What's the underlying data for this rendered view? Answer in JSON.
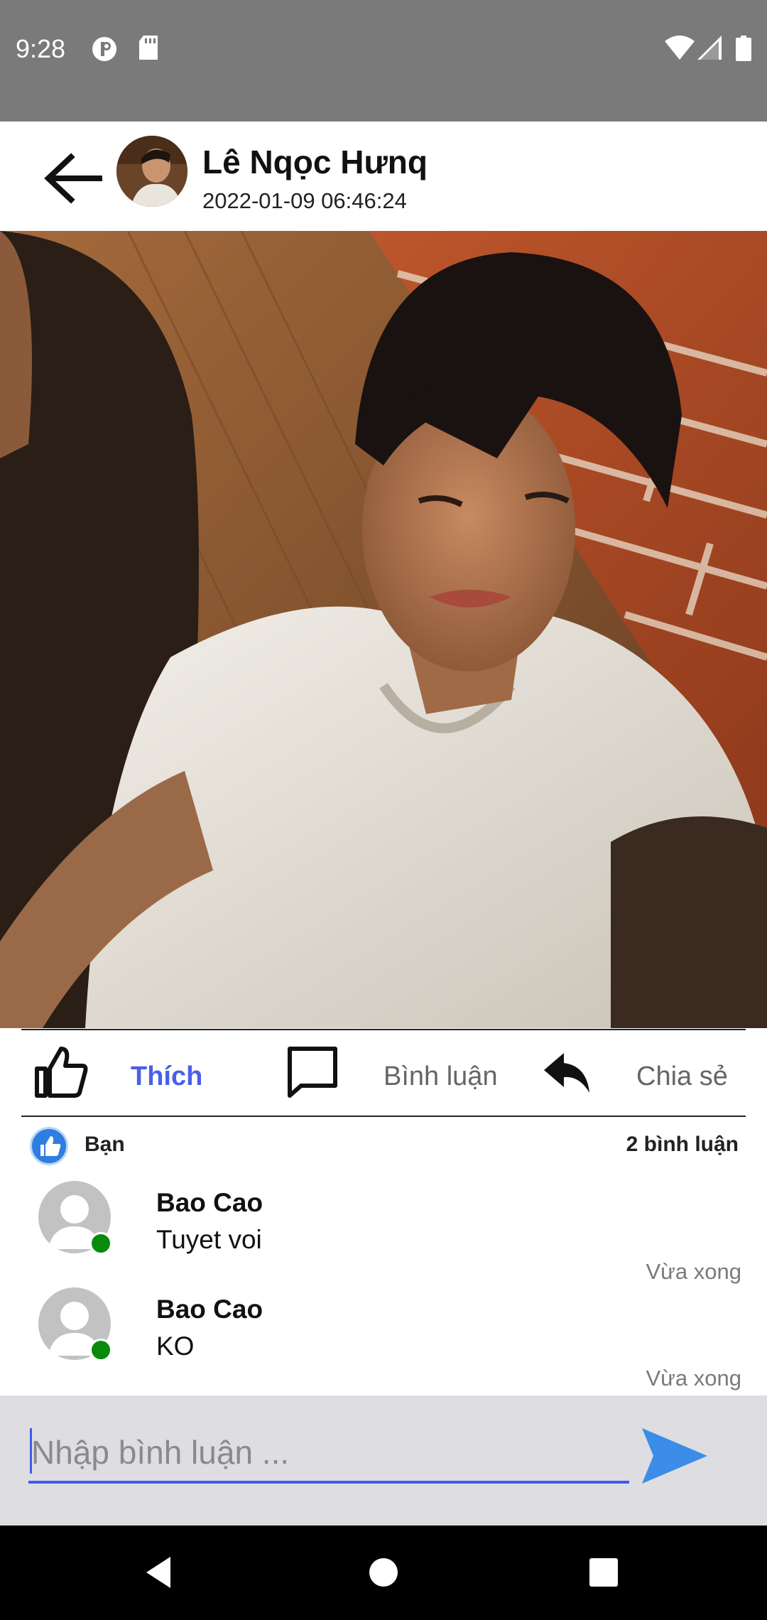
{
  "status_bar": {
    "time": "9:28"
  },
  "header": {
    "user_name": "Lê Nqọc Hưnq",
    "post_time": "2022-01-09 06:46:24"
  },
  "actions": {
    "like": "Thích",
    "comment": "Bình luận",
    "share": "Chia sẻ"
  },
  "reactions": {
    "you": "Bạn",
    "comment_count": "2 bình luận"
  },
  "comments": [
    {
      "name": "Bao Cao",
      "text": "Tuyet voi",
      "time": "Vừa xong"
    },
    {
      "name": "Bao Cao",
      "text": "KO",
      "time": "Vừa xong"
    }
  ],
  "input": {
    "placeholder": "Nhập bình luận ..."
  },
  "colors": {
    "accent": "#3f5bf2",
    "like_active": "#4a60e8",
    "send": "#3b8de8",
    "online": "#0a8a0a"
  }
}
